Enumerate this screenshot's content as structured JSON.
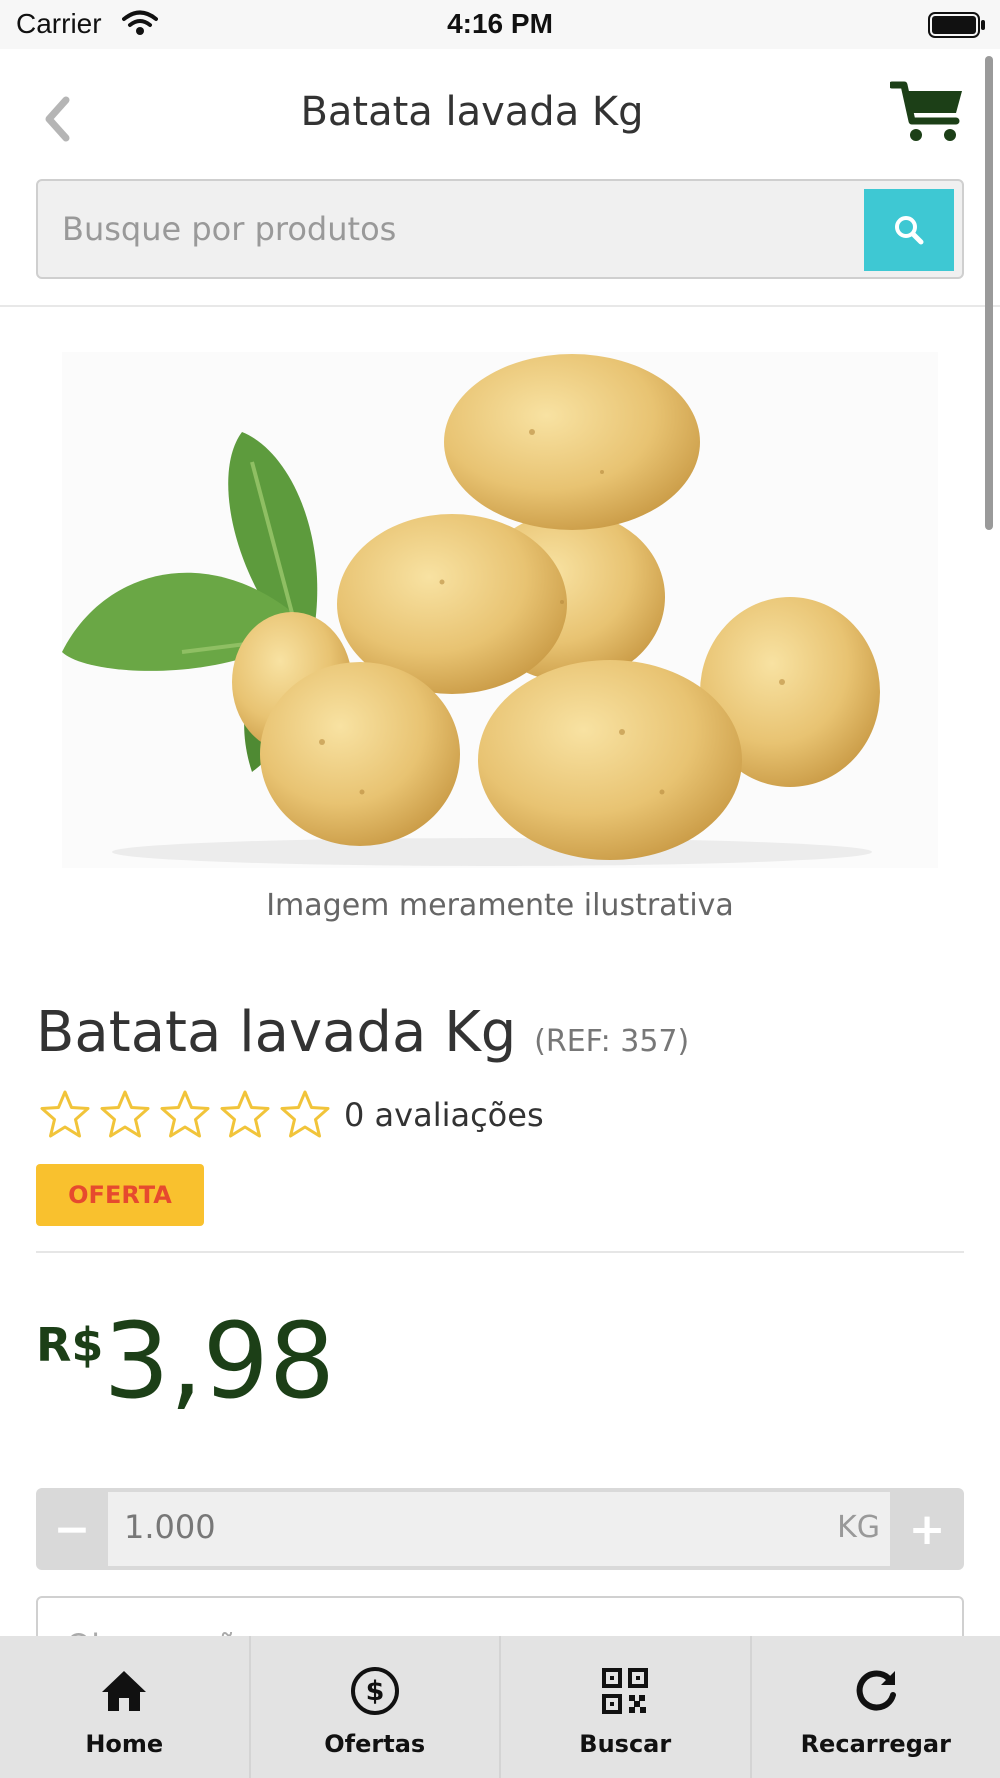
{
  "status_bar": {
    "carrier": "Carrier",
    "time": "4:16 PM"
  },
  "header": {
    "title": "Batata lavada Kg",
    "search_placeholder": "Busque por produtos"
  },
  "product": {
    "image_caption": "Imagem meramente ilustrativa",
    "name": "Batata lavada Kg",
    "ref": "(REF: 357)",
    "rating_count": 0,
    "rating_text": "0 avaliações",
    "stars_total": 5,
    "badge": "OFERTA",
    "price_currency": "R$",
    "price_value": "3,98"
  },
  "quantity": {
    "value": "1.000",
    "unit": "KG",
    "minus_label": "−",
    "plus_label": "+"
  },
  "notes": {
    "placeholder": "Observações"
  },
  "tabs": [
    {
      "label": "Home",
      "icon": "home-icon"
    },
    {
      "label": "Ofertas",
      "icon": "dollar-icon"
    },
    {
      "label": "Buscar",
      "icon": "qr-code-icon"
    },
    {
      "label": "Recarregar",
      "icon": "refresh-icon"
    }
  ],
  "colors": {
    "accent_search": "#3ec8d3",
    "price_green": "#1c3f17",
    "badge_bg": "#f9c12e",
    "badge_text": "#e64a2e",
    "star_outline": "#f1c43a"
  }
}
